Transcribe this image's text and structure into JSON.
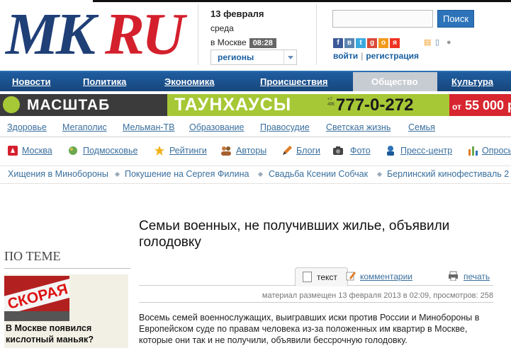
{
  "header": {
    "logo_mk": "MK",
    "logo_ru": "RU",
    "date": "13 февраля",
    "weekday": "среда",
    "time_label": "в Москве",
    "time": "08:28",
    "regions_label": "регионы",
    "search_button": "Поиск",
    "search_placeholder": "",
    "login": "войти",
    "separator": "|",
    "register": "регистрация"
  },
  "main_nav": {
    "items": [
      "Новости",
      "Политика",
      "Экономика",
      "Происшествия",
      "Общество",
      "Культура"
    ],
    "active": "Общество"
  },
  "banner": {
    "brand": "МАСШТАБ",
    "promo": "ТАУНХАУСЫ",
    "phone_prefix": "+7 495",
    "phone": "777-0-272",
    "price_prefix": "от",
    "price": "55 000 р"
  },
  "sub_nav": {
    "items": [
      "Здоровье",
      "Мегаполис",
      "Мельман-ТВ",
      "Образование",
      "Правосудие",
      "Светская жизнь",
      "Семья"
    ]
  },
  "section_nav": {
    "items": [
      "Москва",
      "Подмосковье",
      "Рейтинги",
      "Авторы",
      "Блоги",
      "Фото",
      "Пресс-центр",
      "Опросы"
    ]
  },
  "tags": {
    "items": [
      "Хищения в Минобороны",
      "Покушение на Сергея Филина",
      "Свадьба Ксении Собчак",
      "Берлинский кинофестиваль 2"
    ]
  },
  "article": {
    "title": "Семьи военных, не получивших жилье, объявили голодовку",
    "tab_text": "текст",
    "tab_comments": "комментарии",
    "tab_print": "печать",
    "meta": "материал размещен 13 февраля 2013 в 02:09, просмотров: 258",
    "lead": "Восемь семей военнослужащих, выигравших иски против России и Минобороны в Европейском суде по правам человека из-за положенных им квартир в Москве, которые они так и не получили, объявили бессрочную голодовку."
  },
  "sidebar": {
    "heading": "ПО ТЕМЕ",
    "card_title": "В Москве появился кислотный маньяк?",
    "card_image_text": "СКОРАЯ"
  },
  "colors": {
    "nav_blue": "#1f5da0",
    "link_blue": "#3a6f9d",
    "logo_red": "#d4202d",
    "banner_green": "#a6c836"
  }
}
